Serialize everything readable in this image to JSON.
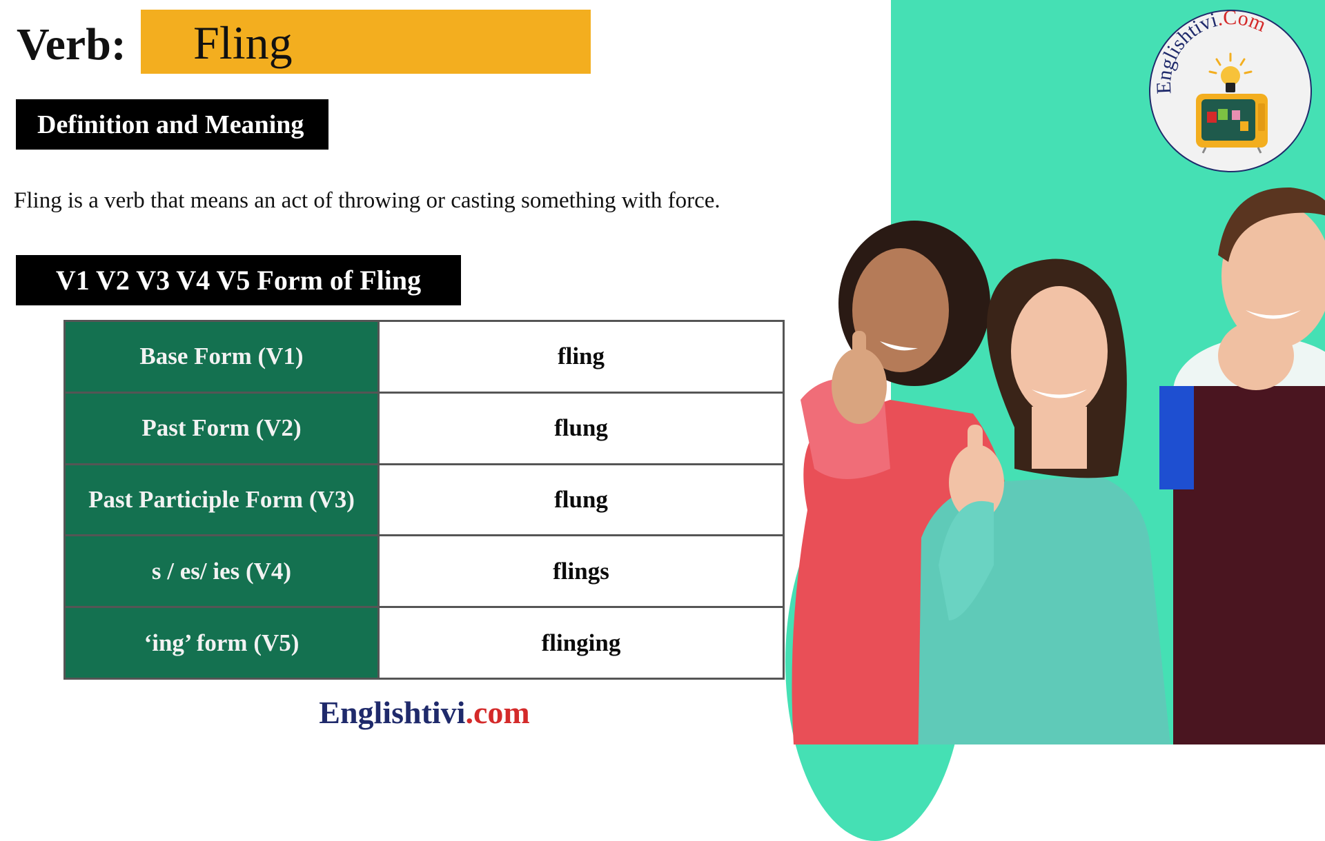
{
  "header": {
    "verb_label": "Verb:",
    "verb_word": "Fling",
    "accent_color": "#f3ae1f"
  },
  "definition_section": {
    "title": "Definition and Meaning",
    "text": "Fling is a verb that means an act of throwing or casting something with force."
  },
  "forms_section": {
    "title": "V1 V2 V3 V4 V5 Form of Fling",
    "header_color": "#147150",
    "rows": [
      {
        "form": "Base Form (V1)",
        "value": "fling"
      },
      {
        "form": "Past Form (V2)",
        "value": "flung"
      },
      {
        "form": "Past Participle Form (V3)",
        "value": "flung"
      },
      {
        "form": "s / es/ ies (V4)",
        "value": "flings"
      },
      {
        "form": "‘ing’ form (V5)",
        "value": "flinging"
      }
    ]
  },
  "footer": {
    "brand": "Englishtivi",
    "tld": ".com"
  },
  "logo": {
    "text_main": "Englishtivi",
    "text_suffix": ".Com",
    "icon": "lightbulb-tv-icon"
  },
  "illustration": {
    "description": "three smiling students giving thumbs up",
    "background_color": "#45e0b4"
  }
}
